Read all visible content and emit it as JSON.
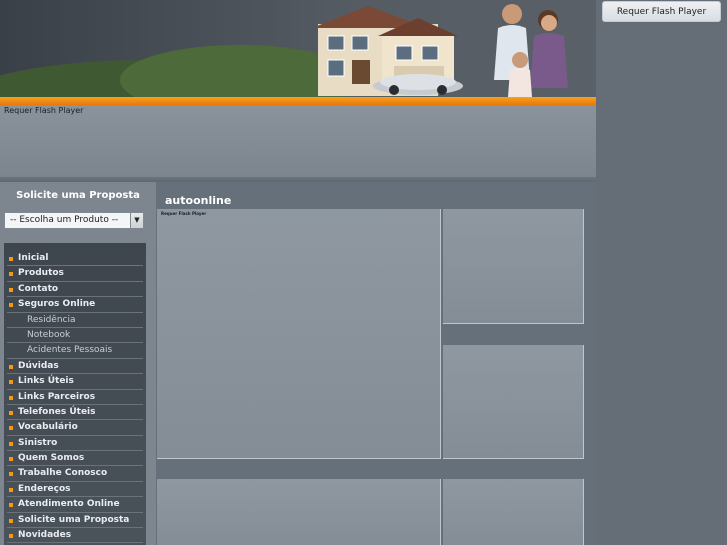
{
  "flash_notice": "Requer Flash Player",
  "right_flash_button": "Requer Flash Player",
  "panel_flash_notice": "Requer Flash Player",
  "proposal": {
    "title": "Solicite uma Proposta",
    "select_value": "-- Escolha um Produto --"
  },
  "menu": [
    {
      "label": "Inicial",
      "sub": false
    },
    {
      "label": "Produtos",
      "sub": false
    },
    {
      "label": "Contato",
      "sub": false
    },
    {
      "label": "Seguros Online",
      "sub": false
    },
    {
      "label": "Residência",
      "sub": true
    },
    {
      "label": "Notebook",
      "sub": true
    },
    {
      "label": "Acidentes Pessoais",
      "sub": true
    },
    {
      "label": "Dúvidas",
      "sub": false
    },
    {
      "label": "Links Úteis",
      "sub": false
    },
    {
      "label": "Links Parceiros",
      "sub": false
    },
    {
      "label": "Telefones Úteis",
      "sub": false
    },
    {
      "label": "Vocabulário",
      "sub": false
    },
    {
      "label": "Sinistro",
      "sub": false
    },
    {
      "label": "Quem Somos",
      "sub": false
    },
    {
      "label": "Trabalhe Conosco",
      "sub": false
    },
    {
      "label": "Endereços",
      "sub": false
    },
    {
      "label": "Atendimento Online",
      "sub": false
    },
    {
      "label": "Solicite uma Proposta",
      "sub": false
    },
    {
      "label": "Novidades",
      "sub": false
    }
  ],
  "main_title": "autoonline",
  "colors": {
    "accent": "#f29a16",
    "menu_bg": "#3e454d",
    "page_bg": "#7d868f"
  }
}
